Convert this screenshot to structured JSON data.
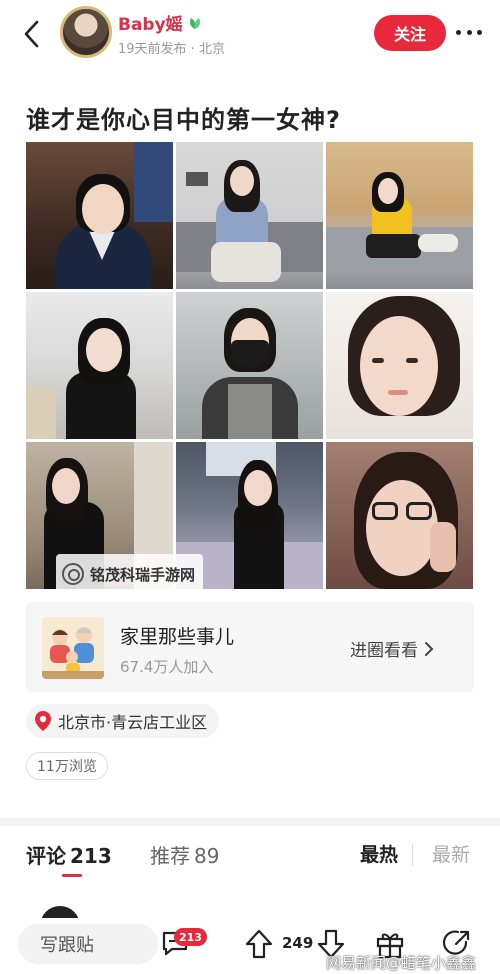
{
  "header": {
    "author_name": "Baby媱",
    "meta": "19天前发布 · 北京",
    "follow_label": "关注"
  },
  "post": {
    "title": "谁才是你心目中的第一女神?"
  },
  "photos": [
    {
      "desc": "police uniform portrait"
    },
    {
      "desc": "woman on sofa with phone"
    },
    {
      "desc": "woman in yellow top"
    },
    {
      "desc": "woman in black top smiling"
    },
    {
      "desc": "woman with black mask"
    },
    {
      "desc": "close-up portrait"
    },
    {
      "desc": "woman in black dress"
    },
    {
      "desc": "woman sitting on bed"
    },
    {
      "desc": "woman with glasses on phone"
    }
  ],
  "watermark": {
    "text": "铭茂科瑞手游网"
  },
  "circle": {
    "name": "家里那些事儿",
    "members": "67.4万人加入",
    "enter_label": "进圈看看"
  },
  "location": {
    "text": "北京市·青云店工业区"
  },
  "views": {
    "text": "11万浏览"
  },
  "tabs": {
    "comments_label": "评论",
    "comments_count": "213",
    "recommend_label": "推荐",
    "recommend_count": "89",
    "sort_hot": "最热",
    "sort_new": "最新"
  },
  "bottom_bar": {
    "write_placeholder": "写跟贴",
    "comment_badge": "213",
    "vote_count": "249"
  },
  "footer": {
    "watermark": "网易新闻@蜡笔小鑫鑫"
  },
  "colors": {
    "accent": "#e8283b",
    "author": "#d8314a"
  }
}
